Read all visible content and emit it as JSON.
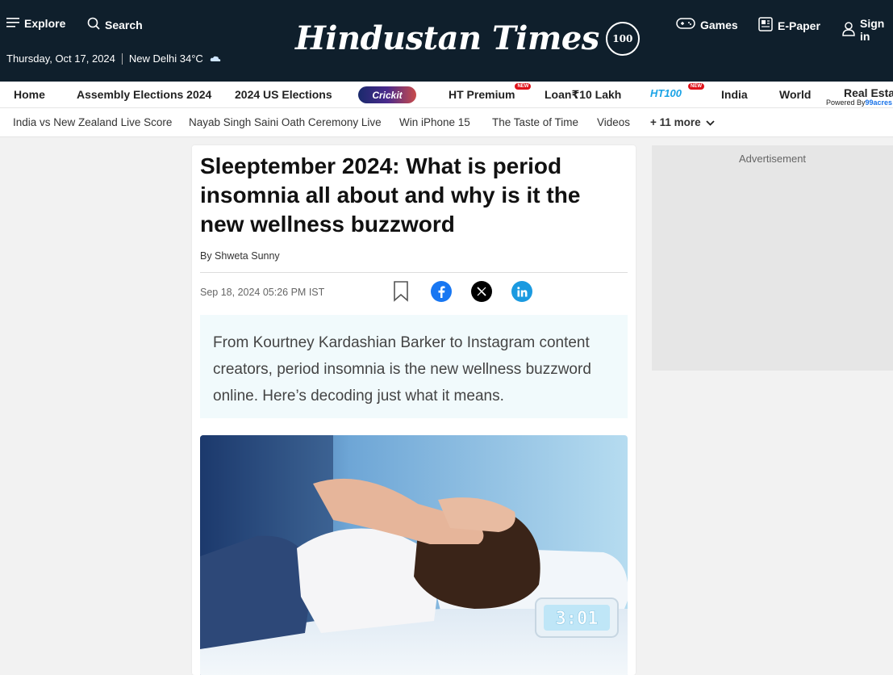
{
  "header": {
    "explore_label": "Explore",
    "search_label": "Search",
    "date_text": "Thursday, Oct 17, 2024",
    "location_weather": "New Delhi 34°C",
    "logo_text": "Hindustan Times",
    "logo_badge": "100",
    "games_label": "Games",
    "epaper_label": "E-Paper",
    "signin_label": "Sign in"
  },
  "main_nav": {
    "items": [
      {
        "label": "Home"
      },
      {
        "label": "Assembly Elections 2024"
      },
      {
        "label": "2024 US Elections"
      },
      {
        "label": "Crickit"
      },
      {
        "label": "HT Premium",
        "badge": "NEW"
      },
      {
        "label": "Loan₹10 Lakh"
      },
      {
        "label": "HT100",
        "badge": "NEW"
      },
      {
        "label": "India"
      },
      {
        "label": "World"
      },
      {
        "label": "Real Estate"
      }
    ],
    "powered_by_prefix": "Powered By",
    "powered_by_brand": "99acres"
  },
  "sub_nav": {
    "items": [
      "India vs New Zealand Live Score",
      "Nayab Singh Saini Oath Ceremony Live",
      "Win iPhone 15",
      "The Taste of Time",
      "Videos"
    ],
    "more_label": "+ 11 more"
  },
  "article": {
    "headline": "Sleeptember 2024: What is period insomnia all about and why is it the new wellness buzzword",
    "byline": "By Shweta Sunny",
    "published": "Sep 18, 2024 05:26 PM IST",
    "summary": "From Kourtney Kardashian Barker to Instagram content creators, period insomnia is the new wellness buzzword online. Here’s decoding just what it means.",
    "clock_display": "3:01"
  },
  "ad": {
    "label": "Advertisement"
  },
  "colors": {
    "header_bg": "#0f1f2c",
    "facebook": "#1877f2",
    "linkedin": "#1b9ae0",
    "summary_bg": "#f1fafc",
    "new_badge": "#e0121a"
  }
}
